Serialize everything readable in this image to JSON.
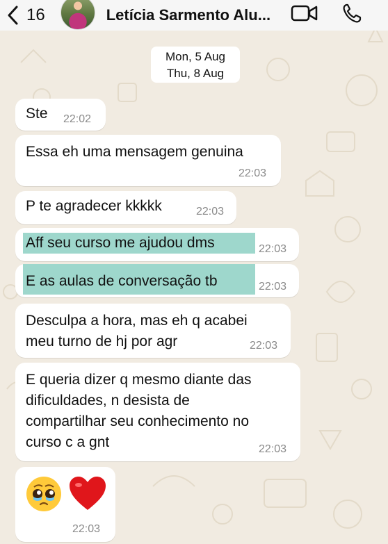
{
  "header": {
    "back_count": "16",
    "contact_name": "Letícia Sarmento Alu..."
  },
  "date_chip": {
    "line1": "Mon, 5 Aug",
    "line2": "Thu, 8 Aug"
  },
  "messages": [
    {
      "lines": [
        "Ste"
      ],
      "time": "22:02"
    },
    {
      "lines": [
        "Essa eh uma mensagem genuina"
      ],
      "time": "22:03"
    },
    {
      "lines": [
        "P te agradecer kkkkk"
      ],
      "time": "22:03"
    },
    {
      "lines": [
        "Aff seu curso me ajudou dms"
      ],
      "time": "22:03",
      "highlighted": true
    },
    {
      "lines": [
        "E as aulas de conversação tb"
      ],
      "time": "22:03",
      "highlighted": true
    },
    {
      "lines": [
        "Desculpa a hora, mas eh q acabei",
        "meu turno de hj por agr"
      ],
      "time": "22:03"
    },
    {
      "lines": [
        "E queria dizer q mesmo diante das",
        "dificuldades, n desista de",
        "compartilhar seu conhecimento no",
        "curso c a gnt"
      ],
      "time": "22:03"
    },
    {
      "emojis": [
        "pleading-face-with-tears-emoji",
        "red-heart-emoji"
      ],
      "time": "22:03"
    }
  ],
  "colors": {
    "background": "#f1ebe1",
    "bubble": "#ffffff",
    "highlight": "#9ed7cc",
    "timestamp": "#8a8a8a"
  }
}
